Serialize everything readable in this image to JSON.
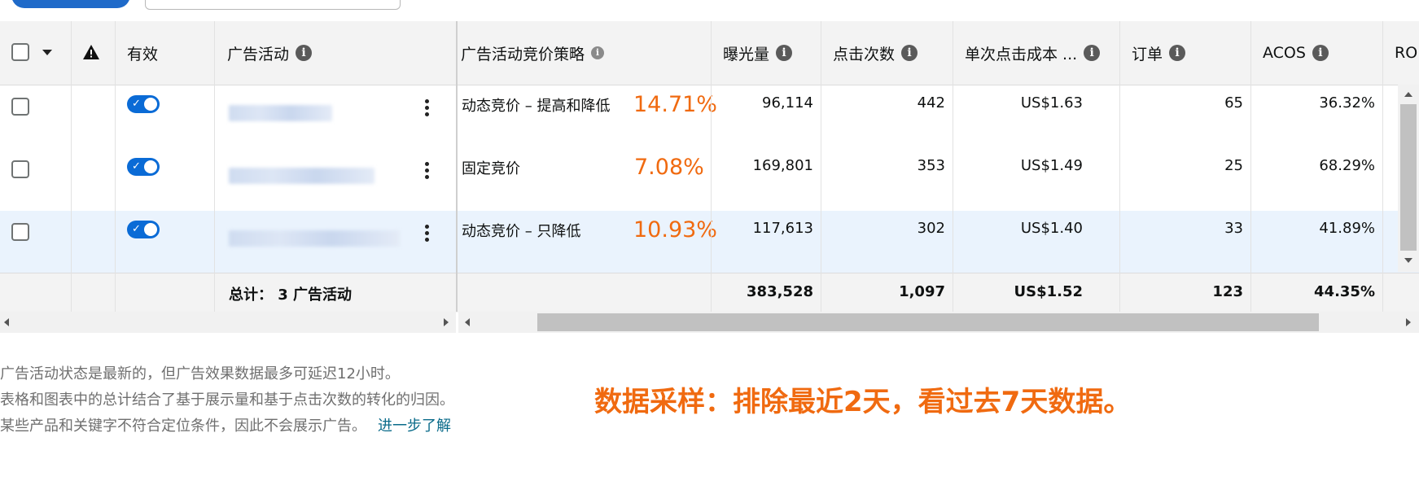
{
  "headers": {
    "active": "有效",
    "campaign": "广告活动",
    "bidding": "广告活动竞价策略",
    "impressions": "曝光量",
    "clicks": "点击次数",
    "cpc": "单次点击成本 ...",
    "orders": "订单",
    "acos": "ACOS",
    "roas": "RO"
  },
  "rows": [
    {
      "bidding": "动态竞价 – 提高和降低",
      "annotation": "14.71%",
      "impressions": "96,114",
      "clicks": "442",
      "cpc": "US$1.63",
      "orders": "65",
      "acos": "36.32%"
    },
    {
      "bidding": "固定竞价",
      "annotation": "7.08%",
      "impressions": "169,801",
      "clicks": "353",
      "cpc": "US$1.49",
      "orders": "25",
      "acos": "68.29%"
    },
    {
      "bidding": "动态竞价 – 只降低",
      "annotation": "10.93%",
      "impressions": "117,613",
      "clicks": "302",
      "cpc": "US$1.40",
      "orders": "33",
      "acos": "41.89%"
    }
  ],
  "totals": {
    "label": "总计：  3 广告活动",
    "impressions": "383,528",
    "clicks": "1,097",
    "cpc": "US$1.52",
    "orders": "123",
    "acos": "44.35%"
  },
  "notes": {
    "line1": "广告活动状态是最新的，但广告效果数据最多可延迟12小时。",
    "line2": "表格和图表中的总计结合了基于展示量和基于点击次数的转化的归因。",
    "line3": "某些产品和关键字不符合定位条件，因此不会展示广告。",
    "learn_more": "进一步了解"
  },
  "banner": "数据采样：排除最近2天，看过去7天数据。",
  "colors": {
    "accent": "#f06a10",
    "toggle": "#0a6bd6",
    "selected_row": "#eaf3fd"
  }
}
